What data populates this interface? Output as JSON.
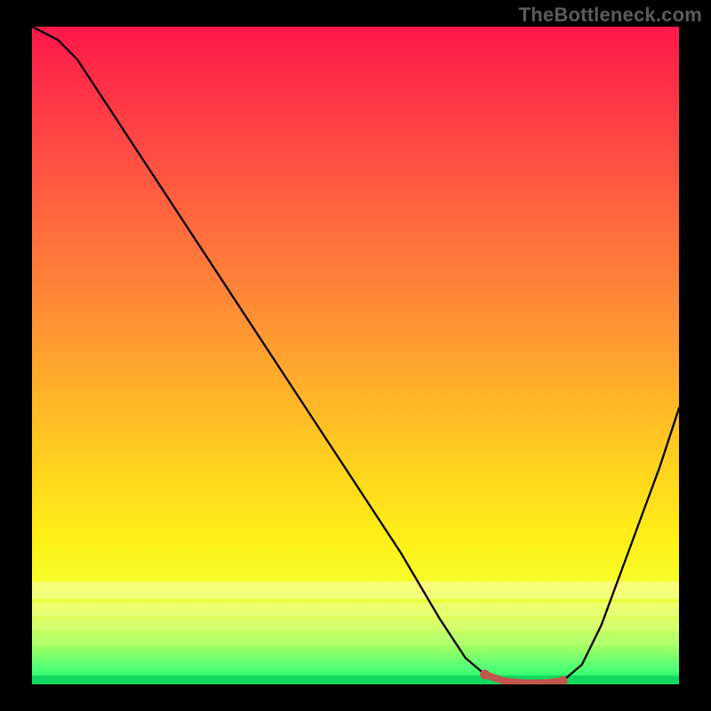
{
  "watermark": "TheBottleneck.com",
  "chart_data": {
    "type": "line",
    "title": "",
    "xlabel": "",
    "ylabel": "",
    "xlim": [
      0,
      100
    ],
    "ylim": [
      0,
      100
    ],
    "grid": false,
    "legend": false,
    "series": [
      {
        "name": "curve",
        "x": [
          0,
          4,
          7,
          17,
          27,
          37,
          47,
          57,
          63,
          67,
          70,
          73,
          76,
          79,
          82,
          85,
          88,
          91,
          94,
          97,
          100
        ],
        "values": [
          100,
          98,
          95,
          80,
          65,
          50,
          35,
          20,
          10,
          4,
          1.5,
          0.5,
          0.2,
          0.2,
          0.5,
          3,
          9,
          17,
          25,
          33,
          42
        ],
        "color": "#000000"
      },
      {
        "name": "highlight-segment",
        "x": [
          70,
          73,
          76,
          79,
          82
        ],
        "values": [
          1.5,
          0.5,
          0.2,
          0.2,
          0.5
        ],
        "color": "#c0564d"
      }
    ],
    "background_gradient": {
      "top": "#ff184c",
      "bottom": "#1cff6e",
      "stops": [
        "red",
        "orange",
        "yellow",
        "green"
      ]
    }
  }
}
